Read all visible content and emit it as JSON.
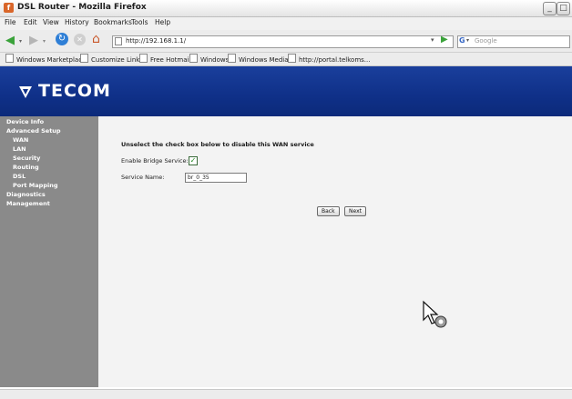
{
  "window": {
    "title": "DSL Router - Mozilla Firefox"
  },
  "menu": [
    "File",
    "Edit",
    "View",
    "History",
    "Bookmarks",
    "Tools",
    "Help"
  ],
  "nav": {
    "url": "http://192.168.1.1/",
    "search_placeholder": "Google"
  },
  "bookmarks": [
    "Windows Marketplace",
    "Customize Links",
    "Free Hotmail",
    "Windows",
    "Windows Media",
    "http://portal.telkoms..."
  ],
  "brand": {
    "name": "TECOM",
    "color": "#0f3088"
  },
  "sidebar": {
    "items": [
      {
        "label": "Device Info",
        "level": 0
      },
      {
        "label": "Advanced Setup",
        "level": 0
      },
      {
        "label": "WAN",
        "level": 1
      },
      {
        "label": "LAN",
        "level": 1
      },
      {
        "label": "Security",
        "level": 1
      },
      {
        "label": "Routing",
        "level": 1
      },
      {
        "label": "DSL",
        "level": 1
      },
      {
        "label": "Port Mapping",
        "level": 1
      },
      {
        "label": "Diagnostics",
        "level": 0
      },
      {
        "label": "Management",
        "level": 0
      }
    ]
  },
  "form": {
    "heading": "Unselect the check box below to disable this WAN service",
    "bridge_label": "Enable Bridge Service:",
    "bridge_checked": true,
    "service_name_label": "Service Name:",
    "service_name_value": "br_0_35",
    "back_label": "Back",
    "next_label": "Next"
  }
}
